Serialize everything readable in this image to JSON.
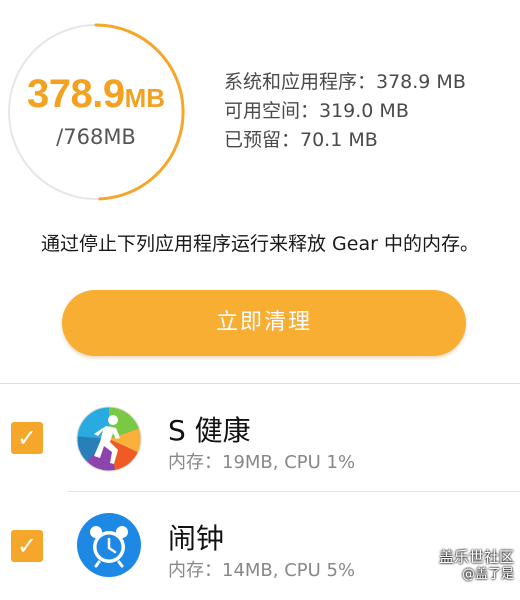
{
  "memory": {
    "used_number": "378.9",
    "used_unit": "MB",
    "total": "/768MB",
    "used_fraction": 0.493,
    "stats": {
      "system_apps": "系统和应用程序：378.9 MB",
      "available": "可用空间：319.0 MB",
      "reserved": "已预留：70.1 MB"
    }
  },
  "description": "通过停止下列应用程序运行来释放 Gear 中的内存。",
  "clean_button_label": "立即清理",
  "apps": [
    {
      "name": "S 健康",
      "meta": "内存：19MB, CPU 1%",
      "checked": true,
      "icon": "s-health-icon"
    },
    {
      "name": "闹钟",
      "meta": "内存：14MB, CPU 5%",
      "checked": true,
      "icon": "alarm-clock-icon"
    }
  ],
  "watermark": {
    "line1": "盖乐世社区",
    "line2": "@盖了是"
  },
  "colors": {
    "accent": "#f8ad33",
    "ring_track": "#e6e6e6",
    "used_text": "#f2a220",
    "alarm_blue": "#1e88e5"
  }
}
